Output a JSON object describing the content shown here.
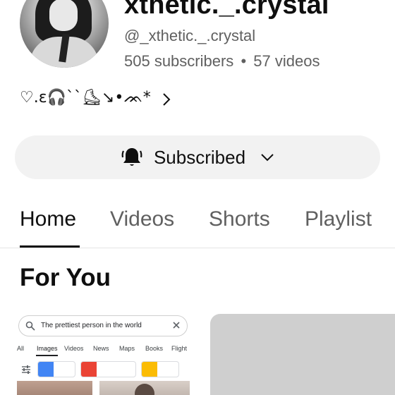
{
  "channel": {
    "name": "xthetic._.crystal",
    "handle": "@_xthetic._.crystal",
    "subscribers": "505 subscribers",
    "separator": "•",
    "videos": "57 videos",
    "bio": "♡.ɛ🎧``⛸↘•ᨏ*"
  },
  "subscribe": {
    "label": "Subscribed",
    "icon": "bell-ring-icon"
  },
  "tabs": [
    {
      "label": "Home",
      "active": true
    },
    {
      "label": "Videos",
      "active": false
    },
    {
      "label": "Shorts",
      "active": false
    },
    {
      "label": "Playlist",
      "active": false
    }
  ],
  "section": {
    "title": "For You"
  },
  "thumbnail": {
    "search_query": "The prettiest person in the world",
    "filters": [
      "All",
      "Images",
      "Videos",
      "News",
      "Maps",
      "Books",
      "Flight"
    ],
    "active_filter": "Images",
    "swatch_colors": [
      "#4285f4",
      "#ea4335",
      "#fbbc04"
    ]
  },
  "colors": {
    "text_primary": "#0f0f0f",
    "text_secondary": "#606060",
    "button_bg": "#f2f2f2"
  }
}
